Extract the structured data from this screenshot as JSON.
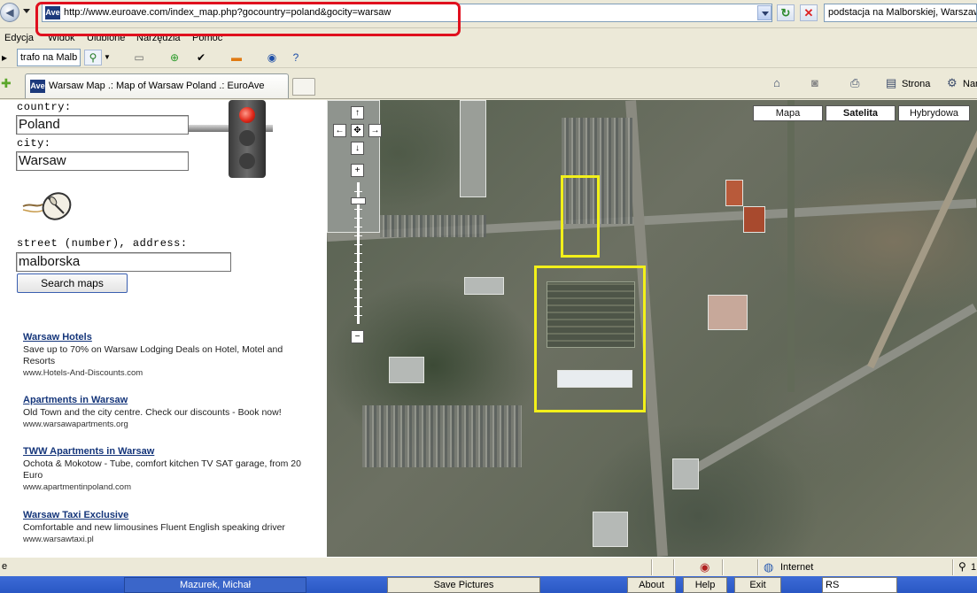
{
  "browser": {
    "url": "http://www.euroave.com/index_map.php?gocountry=poland&gocity=warsaw",
    "address_logo": "Ave",
    "search_query": "podstacja na Malborskiej, Warszaw",
    "menu": [
      "Edycja",
      "Widok",
      "Ulubione",
      "Narzędzia",
      "Pomoc"
    ],
    "toolbar_search": "trafo na Malb",
    "tab_title": "Warsaw Map .: Map of Warsaw Poland .: EuroAve",
    "tab_logo": "Ave",
    "right_tools": {
      "page_label": "Strona",
      "tools_label": "Nar"
    }
  },
  "form": {
    "country_label": "country:",
    "country_value": "Poland",
    "city_label": "city:",
    "city_value": "Warsaw",
    "street_label": "street (number), address:",
    "street_value": "malborska",
    "search_button": "Search maps"
  },
  "ads": [
    {
      "title": "Warsaw Hotels",
      "desc": "Save up to 70% on Warsaw Lodging Deals on Hotel, Motel and Resorts",
      "url": "www.Hotels-And-Discounts.com"
    },
    {
      "title": "Apartments in Warsaw",
      "desc": "Old Town and the city centre. Check our discounts - Book now!",
      "url": "www.warsawapartments.org"
    },
    {
      "title": "TWW Apartments in Warsaw",
      "desc": "Ochota & Mokotow - Tube, comfort kitchen TV SAT garage, from 20 Euro",
      "url": "www.apartmentinpoland.com"
    },
    {
      "title": "Warsaw Taxi Exclusive",
      "desc": "Comfortable and new limousines Fluent English speaking driver",
      "url": "www.warsawtaxi.pl"
    }
  ],
  "map": {
    "types": [
      "Mapa",
      "Satelita",
      "Hybrydowa"
    ],
    "active_type": "Satelita",
    "nav": {
      "up": "↑",
      "down": "↓",
      "left": "←",
      "right": "→",
      "center": "✥",
      "zoom_in": "+",
      "zoom_out": "−"
    },
    "highlight_color": "#f2f01a"
  },
  "status": {
    "left_text": "e",
    "zone": "Internet",
    "zoom": "1"
  },
  "taskbar": {
    "task_1": "Mazurek, Michał",
    "task_2": "Save Pictures",
    "task_3": "About",
    "task_4": "Help",
    "task_5": "Exit",
    "task_6": "RS"
  },
  "colors": {
    "address_highlight": "#e0101e",
    "link": "#14357a"
  }
}
